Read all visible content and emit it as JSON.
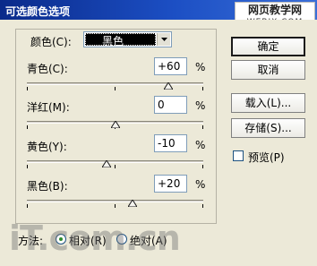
{
  "window": {
    "title": "可选颜色选项"
  },
  "watermark": {
    "main": "网页教学网",
    "sub": "WEBJX.COM"
  },
  "colors": {
    "row_label": "颜色(C):",
    "selected_value": "黑色"
  },
  "sliders": [
    {
      "label": "青色(C):",
      "value": "+60",
      "unit": "%",
      "level": 0.8
    },
    {
      "label": "洋红(M):",
      "value": "0",
      "unit": "%",
      "level": 0.5
    },
    {
      "label": "黄色(Y):",
      "value": "-10",
      "unit": "%",
      "level": 0.45
    },
    {
      "label": "黑色(B):",
      "value": "+20",
      "unit": "%",
      "level": 0.6
    }
  ],
  "buttons": {
    "ok": "确定",
    "cancel": "取消",
    "load": "载入(L)...",
    "save": "存储(S)..."
  },
  "preview": {
    "label": "预览(P)",
    "checked": false
  },
  "method": {
    "label": "方法:",
    "options": [
      {
        "label": "相对(R)",
        "selected": true
      },
      {
        "label": "绝对(A)",
        "selected": false
      }
    ]
  },
  "logo": {
    "text": "iT.com.cn"
  }
}
